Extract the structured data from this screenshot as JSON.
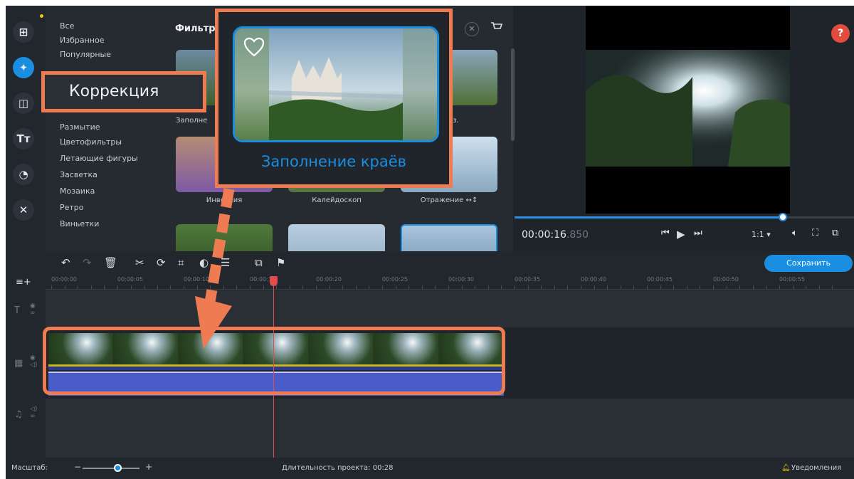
{
  "categories": [
    "Все",
    "Избранное",
    "Популярные",
    "Размытие",
    "Цветофильтры",
    "Летающие фигуры",
    "Засветка",
    "Мозаика",
    "Ретро",
    "Виньетки"
  ],
  "callout_label": "Коррекция",
  "filters": {
    "title": "Фильтры",
    "clear_glyph": "✕",
    "partial_labels": [
      "Заполне",
      "ориз."
    ],
    "thumb_labels": [
      "Инверсия",
      "Калейдоскоп",
      "Отражение ↔↕"
    ]
  },
  "zoom_card": {
    "label": "Заполнение краёв"
  },
  "preview": {
    "help_label": "?",
    "time_main": "00:00:16",
    "time_ms": ".850",
    "progress": 0.79,
    "ratio_label": "1:1 ▾"
  },
  "toolbar": {
    "save_label": "Сохранить"
  },
  "ruler_labels": [
    "00:00:00",
    "00:00:05",
    "00:00:10",
    "00:00:15",
    "00:00:20",
    "00:00:25",
    "00:00:30",
    "00:00:35",
    "00:00:40",
    "00:00:45",
    "00:00:50",
    "00:00:55"
  ],
  "status": {
    "zoom_label": "Масштаб:",
    "duration_label": "Длительность проекта: 00:28",
    "notifications_label": "Уведомления"
  },
  "colors": {
    "accent": "#1a8ee0",
    "highlight": "#ef7b53",
    "background": "#1f232a",
    "clip_audio": "#4a5cc8"
  },
  "icons": [
    "add-media-icon",
    "magic-wand-icon",
    "transitions-icon",
    "titles-icon",
    "stickers-icon",
    "tools-icon",
    "cart-icon",
    "undo-icon",
    "redo-icon",
    "delete-icon",
    "cut-icon",
    "rotate-icon",
    "crop-icon",
    "color-adjust-icon",
    "clip-properties-icon",
    "overlay-icon",
    "marker-flag-icon",
    "prev-frame-icon",
    "play-icon",
    "next-frame-icon",
    "volume-icon",
    "fullscreen-icon",
    "external-icon",
    "bell-icon",
    "heart-icon"
  ]
}
